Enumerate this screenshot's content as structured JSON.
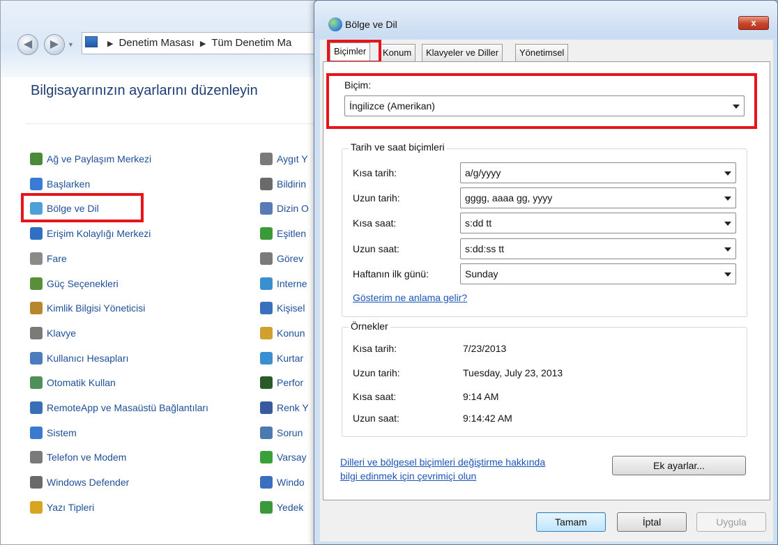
{
  "control_panel": {
    "breadcrumb": [
      "Denetim Masası",
      "Tüm Denetim Ma"
    ],
    "title": "Bilgisayarınızın ayarlarını düzenleyin",
    "items_col1": [
      {
        "label": "Ağ ve Paylaşım Merkezi",
        "icon": "network-icon",
        "color": "#4a8a3a"
      },
      {
        "label": "Başlarken",
        "icon": "getting-started-icon",
        "color": "#3a7bd5"
      },
      {
        "label": "Bölge ve Dil",
        "icon": "globe-icon",
        "color": "#4fa0d8"
      },
      {
        "label": "Erişim Kolaylığı Merkezi",
        "icon": "ease-of-access-icon",
        "color": "#2f6fc4"
      },
      {
        "label": "Fare",
        "icon": "mouse-icon",
        "color": "#8a8a8a"
      },
      {
        "label": "Güç Seçenekleri",
        "icon": "power-icon",
        "color": "#5a8f3a"
      },
      {
        "label": "Kimlik Bilgisi Yöneticisi",
        "icon": "credential-icon",
        "color": "#b8862d"
      },
      {
        "label": "Klavye",
        "icon": "keyboard-icon",
        "color": "#7a7a7a"
      },
      {
        "label": "Kullanıcı Hesapları",
        "icon": "users-icon",
        "color": "#4a7dbd"
      },
      {
        "label": "Otomatik Kullan",
        "icon": "autoplay-icon",
        "color": "#4f8f5a"
      },
      {
        "label": "RemoteApp ve Masaüstü Bağlantıları",
        "icon": "remote-icon",
        "color": "#3a6fb5"
      },
      {
        "label": "Sistem",
        "icon": "system-icon",
        "color": "#3a7ad0"
      },
      {
        "label": "Telefon ve Modem",
        "icon": "phone-icon",
        "color": "#7a7a7a"
      },
      {
        "label": "Windows Defender",
        "icon": "defender-icon",
        "color": "#6a6a6a"
      },
      {
        "label": "Yazı Tipleri",
        "icon": "fonts-icon",
        "color": "#d9a520"
      }
    ],
    "items_col2": [
      {
        "label": "Aygıt Y",
        "icon": "device-icon",
        "color": "#7a7a7a"
      },
      {
        "label": "Bildirin",
        "icon": "notification-icon",
        "color": "#6a6a6a"
      },
      {
        "label": "Dizin O",
        "icon": "indexing-icon",
        "color": "#5a7ab5"
      },
      {
        "label": "Eşitlen",
        "icon": "sync-icon",
        "color": "#3a9a3a"
      },
      {
        "label": "Görev",
        "icon": "taskbar-icon",
        "color": "#7a7a7a"
      },
      {
        "label": "Interne",
        "icon": "internet-icon",
        "color": "#3a8fd0"
      },
      {
        "label": "Kişisel",
        "icon": "personalize-icon",
        "color": "#3a6fc0"
      },
      {
        "label": "Konun",
        "icon": "location-icon",
        "color": "#d0a030"
      },
      {
        "label": "Kurtar",
        "icon": "recovery-icon",
        "color": "#3a8fd0"
      },
      {
        "label": "Perfor",
        "icon": "performance-icon",
        "color": "#2a5a2a"
      },
      {
        "label": "Renk Y",
        "icon": "color-icon",
        "color": "#3a5aa0"
      },
      {
        "label": "Sorun",
        "icon": "troubleshoot-icon",
        "color": "#4a7ab0"
      },
      {
        "label": "Varsay",
        "icon": "defaults-icon",
        "color": "#3aa03a"
      },
      {
        "label": "Windo",
        "icon": "windows-icon",
        "color": "#3a6fc0"
      },
      {
        "label": "Yedek",
        "icon": "backup-icon",
        "color": "#3a9a3a"
      }
    ]
  },
  "dialog": {
    "title": "Bölge ve Dil",
    "close_label": "x",
    "tabs": [
      "Biçimler",
      "Konum",
      "Klavyeler ve Diller",
      "Yönetimsel"
    ],
    "format_label": "Biçim:",
    "format_value": "İngilizce (Amerikan)",
    "datetime_group": "Tarih ve saat biçimleri",
    "fields": [
      {
        "label": "Kısa tarih:",
        "value": "a/g/yyyy"
      },
      {
        "label": "Uzun tarih:",
        "value": "gggg, aaaa gg, yyyy"
      },
      {
        "label": "Kısa saat:",
        "value": "s:dd tt"
      },
      {
        "label": "Uzun saat:",
        "value": "s:dd:ss tt"
      },
      {
        "label": "Haftanın ilk günü:",
        "value": "Sunday"
      }
    ],
    "notation_link": "Gösterim ne anlama gelir?",
    "examples_group": "Örnekler",
    "examples": [
      {
        "label": "Kısa tarih:",
        "value": "7/23/2013"
      },
      {
        "label": "Uzun tarih:",
        "value": "Tuesday, July 23, 2013"
      },
      {
        "label": "Kısa saat:",
        "value": "9:14 AM"
      },
      {
        "label": "Uzun saat:",
        "value": "9:14:42 AM"
      }
    ],
    "online_link_line1": "Dilleri ve bölgesel biçimleri değiştirme hakkında",
    "online_link_line2": "bilgi edinmek için çevrimiçi olun",
    "additional_button": "Ek ayarlar...",
    "ok_button": "Tamam",
    "cancel_button": "İptal",
    "apply_button": "Uygula",
    "highlight_color": "#e8141c"
  }
}
